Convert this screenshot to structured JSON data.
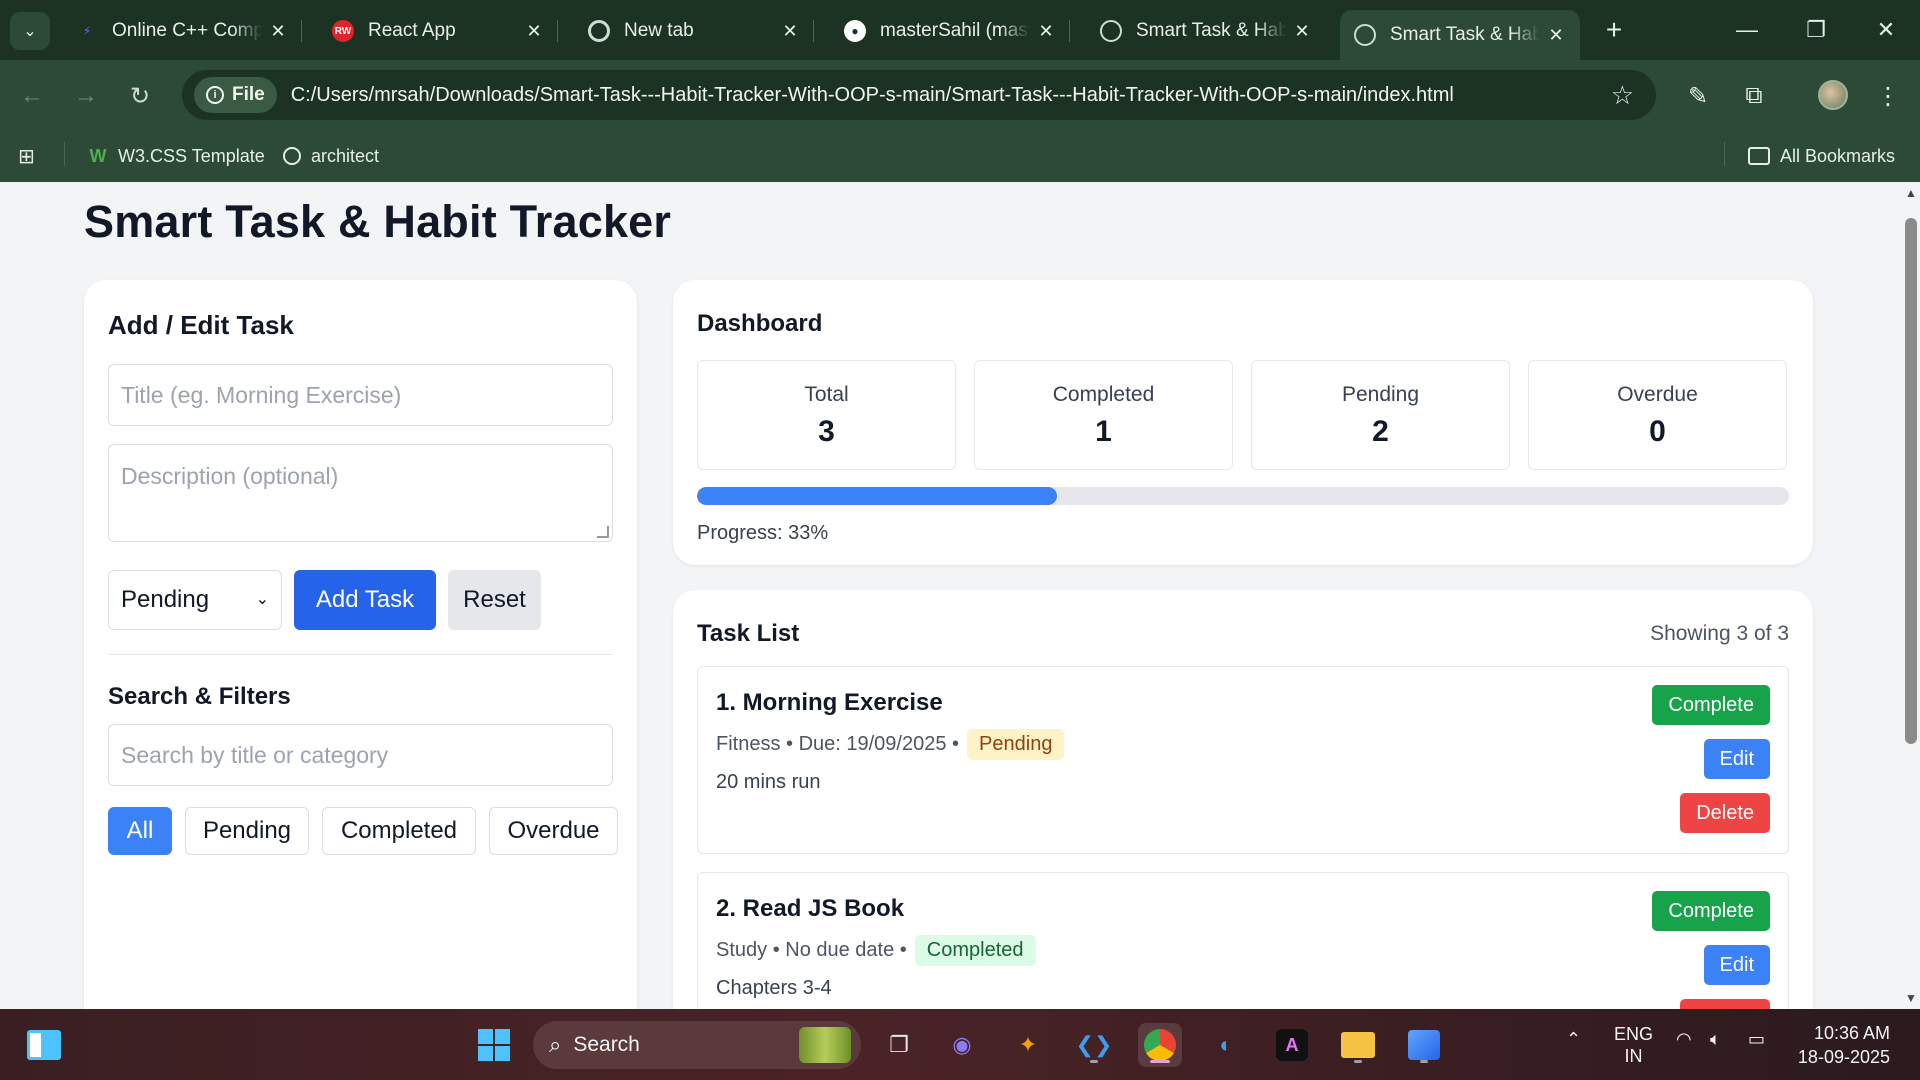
{
  "browser": {
    "tabs": [
      {
        "title": "Online C++ Compi",
        "favicon": "code-favicon",
        "color": "#7c5cff"
      },
      {
        "title": "React App",
        "favicon": "react-favicon",
        "color": "#e0242a"
      },
      {
        "title": "New tab",
        "favicon": "chrome-favicon",
        "color": "#cfdcd2"
      },
      {
        "title": "masterSahil (maste",
        "favicon": "github-favicon",
        "color": "#ffffff"
      },
      {
        "title": "Smart Task & Habi",
        "favicon": "globe-favicon",
        "color": "#cfdcd2"
      },
      {
        "title": "Smart Task & Habi",
        "favicon": "globe-favicon",
        "color": "#cfdcd2",
        "active": true
      }
    ],
    "file_chip": "File",
    "url": "C:/Users/mrsah/Downloads/Smart-Task---Habit-Tracker-With-OOP-s-main/Smart-Task---Habit-Tracker-With-OOP-s-main/index.html",
    "bookmarks": [
      {
        "label": "W3.CSS Template",
        "icon": "w3-icon"
      },
      {
        "label": "architect",
        "icon": "globe-icon"
      }
    ],
    "all_bookmarks": "All Bookmarks"
  },
  "page": {
    "title": "Smart Task & Habit Tracker",
    "form": {
      "heading": "Add / Edit Task",
      "title_placeholder": "Title (eg. Morning Exercise)",
      "description_placeholder": "Description (optional)",
      "status_selected": "Pending",
      "add_label": "Add Task",
      "reset_label": "Reset"
    },
    "filters": {
      "heading": "Search & Filters",
      "search_placeholder": "Search by title or category",
      "options": [
        "All",
        "Pending",
        "Completed",
        "Overdue"
      ],
      "active": "All"
    },
    "dashboard": {
      "heading": "Dashboard",
      "stats": [
        {
          "label": "Total",
          "value": "3"
        },
        {
          "label": "Completed",
          "value": "1"
        },
        {
          "label": "Pending",
          "value": "2"
        },
        {
          "label": "Overdue",
          "value": "0"
        }
      ],
      "progress_percent": 33,
      "progress_text": "Progress: 33%"
    },
    "tasklist": {
      "heading": "Task List",
      "showing": "Showing 3 of 3",
      "tasks": [
        {
          "name": "1. Morning Exercise",
          "meta": "Fitness • Due: 19/09/2025 •",
          "status": "Pending",
          "desc": "20 mins run"
        },
        {
          "name": "2. Read JS Book",
          "meta": "Study • No due date •",
          "status": "Completed",
          "desc": "Chapters 3-4"
        }
      ],
      "buttons": {
        "complete": "Complete",
        "edit": "Edit",
        "delete": "Delete"
      }
    }
  },
  "taskbar": {
    "search_label": "Search",
    "lang_line1": "ENG",
    "lang_line2": "IN",
    "time": "10:36 AM",
    "date": "18-09-2025"
  }
}
